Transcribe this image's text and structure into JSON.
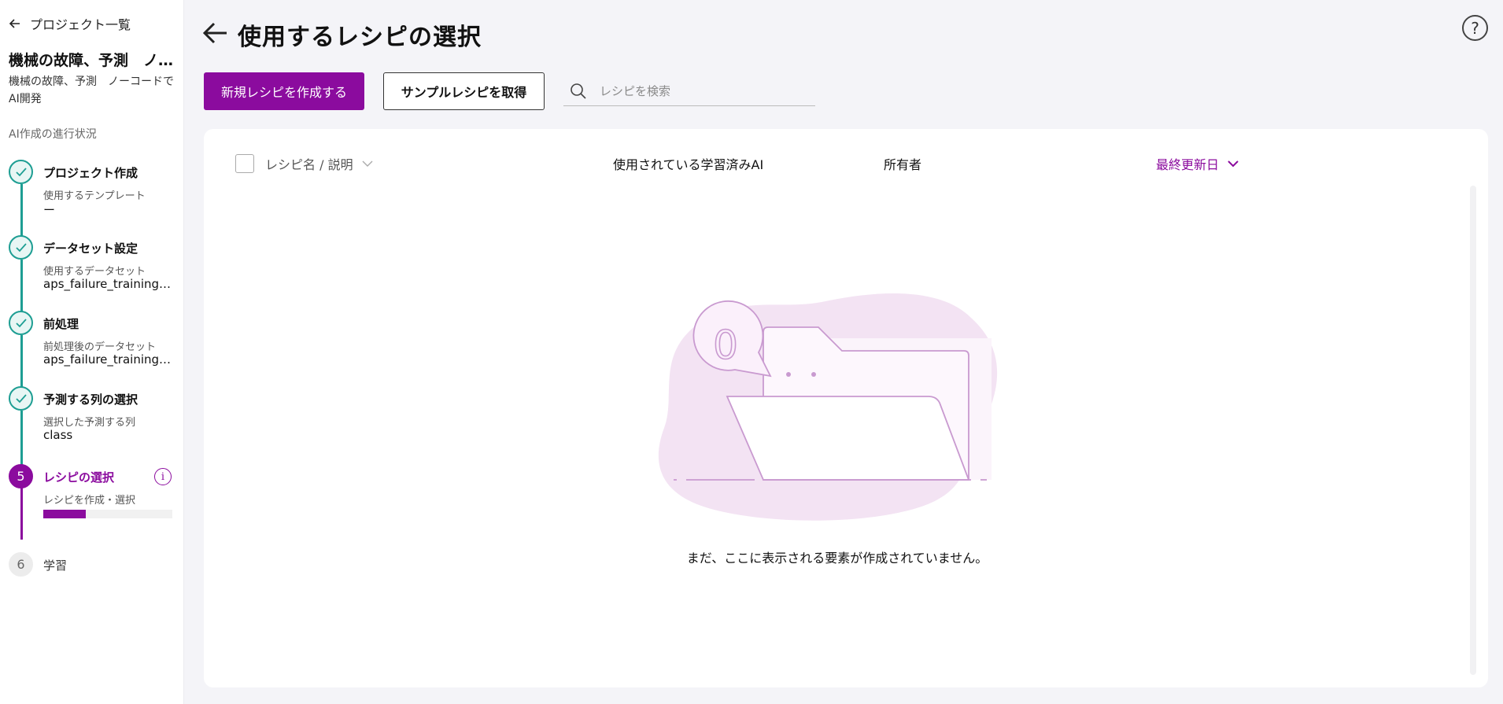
{
  "sidebar": {
    "back_label": "プロジェクト一覧",
    "project_title": "機械の故障、予測　ノーコードでAI開発",
    "project_desc": "機械の故障、予測　ノーコードでAI開発",
    "progress_heading": "AI作成の進行状況",
    "steps": [
      {
        "title": "プロジェクト作成",
        "sub": "使用するテンプレート",
        "value": "ー",
        "status": "done"
      },
      {
        "title": "データセット設定",
        "sub": "使用するデータセット",
        "value": "aps_failure_training_set",
        "status": "done"
      },
      {
        "title": "前処理",
        "sub": "前処理後のデータセット",
        "value": "aps_failure_training_set",
        "status": "done"
      },
      {
        "title": "予測する列の選択",
        "sub": "選択した予測する列",
        "value": "class",
        "status": "done"
      },
      {
        "number": "5",
        "title": "レシピの選択",
        "sub": "レシピを作成・選択",
        "status": "active",
        "progress": 0.33
      },
      {
        "number": "6",
        "title": "学習",
        "status": "pending"
      }
    ],
    "info_glyph": "i"
  },
  "header": {
    "title": "使用するレシピの選択",
    "help_glyph": "?"
  },
  "toolbar": {
    "create_label": "新規レシピを作成する",
    "sample_label": "サンプルレシピを取得",
    "search_placeholder": "レシピを検索"
  },
  "table": {
    "columns": {
      "name": "レシピ名 / 説明",
      "ai": "使用されている学習済みAI",
      "owner": "所有者",
      "date": "最終更新日"
    },
    "rows": [],
    "empty_message": "まだ、ここに表示される要素が作成されていません。",
    "empty_count_glyph": "0"
  },
  "colors": {
    "accent": "#8b0b9e",
    "done": "#1e9e93",
    "illustration_blob": "#f3e3f3",
    "illustration_stroke": "#c99ad0"
  }
}
